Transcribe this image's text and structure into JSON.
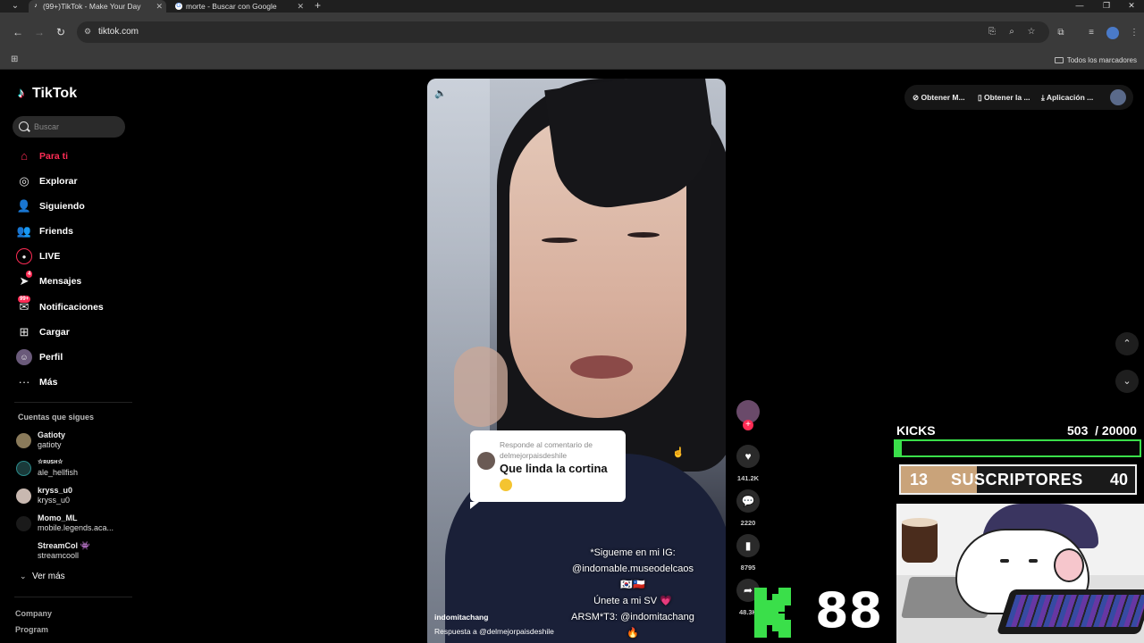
{
  "browser": {
    "tabs": [
      {
        "title": "(99+)TikTok - Make Your Day",
        "icon": "tiktok-icon"
      },
      {
        "title": "morte - Buscar con Google",
        "icon": "google-icon"
      }
    ],
    "url": "tiktok.com",
    "bookmarks_all": "Todos los marcadores"
  },
  "tiktok": {
    "logo": "TikTok",
    "search_placeholder": "Buscar",
    "nav": [
      {
        "label": "Para ti",
        "icon": "home-icon"
      },
      {
        "label": "Explorar",
        "icon": "compass-icon"
      },
      {
        "label": "Siguiendo",
        "icon": "following-icon"
      },
      {
        "label": "Friends",
        "icon": "friends-icon"
      },
      {
        "label": "LIVE",
        "icon": "live-icon"
      },
      {
        "label": "Mensajes",
        "icon": "messages-icon",
        "badge": "4"
      },
      {
        "label": "Notificaciones",
        "icon": "notifications-icon",
        "badge": "99+"
      },
      {
        "label": "Cargar",
        "icon": "upload-icon"
      },
      {
        "label": "Perfil",
        "icon": "profile-icon"
      },
      {
        "label": "Más",
        "icon": "more-icon"
      }
    ],
    "following_title": "Cuentas que sigues",
    "following": [
      {
        "name": "Gatioty",
        "handle": "gatioty"
      },
      {
        "name": "☆ʀᴜꜱʜ☆",
        "handle": "ale_hellfish"
      },
      {
        "name": "kryss_u0",
        "handle": "kryss_u0"
      },
      {
        "name": "Momo_ML",
        "handle": "mobile.legends.aca..."
      },
      {
        "name": "StreamCol 👾",
        "handle": "streamcooll"
      }
    ],
    "see_more": "Ver más",
    "footer": [
      "Company",
      "Program"
    ]
  },
  "video": {
    "reply_header": "Responde al comentario de delmejorpaisdeshile",
    "reply_text": "Que linda la cortina",
    "overlay_lines": [
      "*Sigueme en mi IG:",
      "@indomable.museodelcaos",
      "🇰🇷🇨🇱",
      "Únete a mi SV 💗",
      "ARSM*T3: @indomitachang",
      "🔥"
    ],
    "author": "indomitachang",
    "reply_to": "Respuesta a @delmejorpaisdeshile",
    "likes": "141.2K",
    "comments": "2220",
    "saves": "8795",
    "shares": "48.3K"
  },
  "header_actions": [
    "Obtener M...",
    "Obtener la ...",
    "Aplicación ..."
  ],
  "overlay": {
    "kicks_label": "KICKS",
    "kicks_current": "503",
    "kicks_goal": "/ 20000",
    "kicks_progress": 0.025,
    "subs_current": "13",
    "subs_label": "SUSCRIPTORES",
    "subs_goal": "40",
    "subs_progress": 0.325,
    "kick_count": "88",
    "colors": {
      "kick_green": "#3adf4a",
      "tiktok_red": "#fe2c55"
    }
  }
}
